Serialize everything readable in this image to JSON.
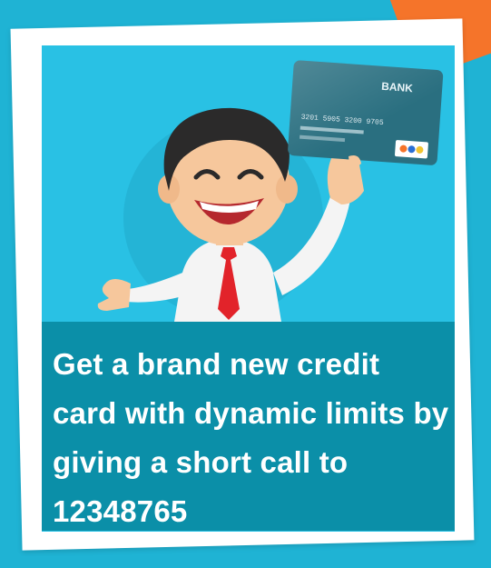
{
  "ad": {
    "card_brand": "BANK",
    "card_number": "3201 5905 3200 9705",
    "caption": "Get a brand new credit card with dynamic limits by giving a short call to 12348765"
  },
  "colors": {
    "background": "#1fb3d4",
    "photo_bg": "#29c1e4",
    "caption_bg": "#0b8fa8",
    "accent": "#f5742a",
    "card": "#2a6f80",
    "tie": "#e2232a"
  },
  "icons": [
    "businessman-illustration",
    "credit-card-icon"
  ]
}
